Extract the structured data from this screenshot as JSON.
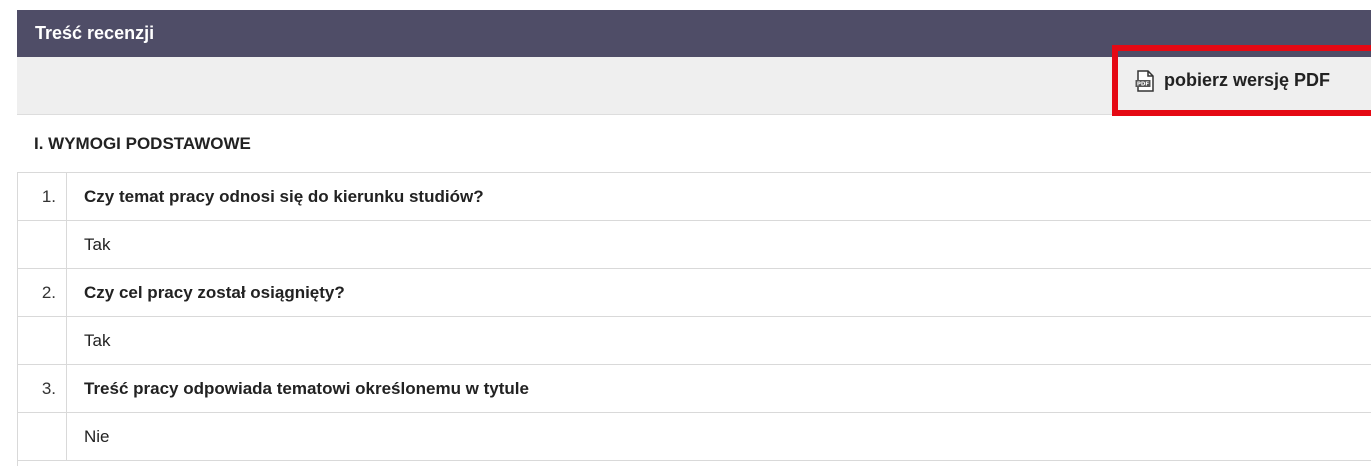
{
  "header": {
    "title": "Treść recenzji"
  },
  "toolbar": {
    "pdf_label": "pobierz wersję PDF",
    "pdf_icon": "pdf-file-icon",
    "highlight_color": "#e50914"
  },
  "section": {
    "title": "I. WYMOGI PODSTAWOWE"
  },
  "questions": [
    {
      "number": "1.",
      "question": "Czy temat pracy odnosi się do kierunku studiów?",
      "answer": "Tak"
    },
    {
      "number": "2.",
      "question": "Czy cel pracy został osiągnięty?",
      "answer": "Tak"
    },
    {
      "number": "3.",
      "question": "Treść pracy odpowiada tematowi określonemu w tytule",
      "answer": "Nie"
    }
  ],
  "colors": {
    "header_bg": "#4f4d67",
    "toolbar_bg": "#efefef",
    "border": "#d9d9d9"
  }
}
